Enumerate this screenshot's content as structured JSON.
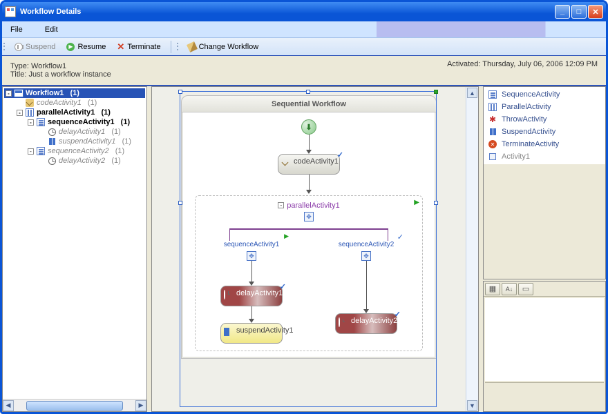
{
  "window": {
    "title": "Workflow Details"
  },
  "menu": {
    "file": "File",
    "edit": "Edit"
  },
  "toolbar": {
    "suspend": "Suspend",
    "resume": "Resume",
    "terminate": "Terminate",
    "change": "Change Workflow"
  },
  "info": {
    "type_label": "Type:",
    "type_value": "Workflow1",
    "title_label": "Title:",
    "title_value": "Just a workflow instance",
    "activated_label": "Activated:",
    "activated_value": "Thursday, July 06, 2006 12:09 PM"
  },
  "tree": {
    "root": {
      "label": "Workflow1",
      "count": "(1)"
    },
    "code1": {
      "label": "codeActivity1",
      "count": "(1)"
    },
    "parallel1": {
      "label": "parallelActivity1",
      "count": "(1)"
    },
    "seq1": {
      "label": "sequenceActivity1",
      "count": "(1)"
    },
    "delay1": {
      "label": "delayActivity1",
      "count": "(1)"
    },
    "suspend1": {
      "label": "suspendActivity1",
      "count": "(1)"
    },
    "seq2": {
      "label": "sequenceActivity2",
      "count": "(1)"
    },
    "delay2": {
      "label": "delayActivity2",
      "count": "(1)"
    }
  },
  "designer": {
    "header": "Sequential Workflow",
    "code1": "codeActivity1",
    "parallel": "parallelActivity1",
    "seq1": "sequenceActivity1",
    "seq2": "sequenceActivity2",
    "delay1": "delayActivity1",
    "delay2": "delayActivity2",
    "suspend1": "suspendActivity1"
  },
  "toolbox": {
    "items": [
      {
        "label": "SequenceActivity",
        "icon": "seq"
      },
      {
        "label": "ParallelActivity",
        "icon": "par"
      },
      {
        "label": "ThrowActivity",
        "icon": "throw"
      },
      {
        "label": "SuspendActivity",
        "icon": "susp"
      },
      {
        "label": "TerminateActivity",
        "icon": "term"
      },
      {
        "label": "Activity1",
        "icon": "act",
        "gray": true
      }
    ]
  }
}
